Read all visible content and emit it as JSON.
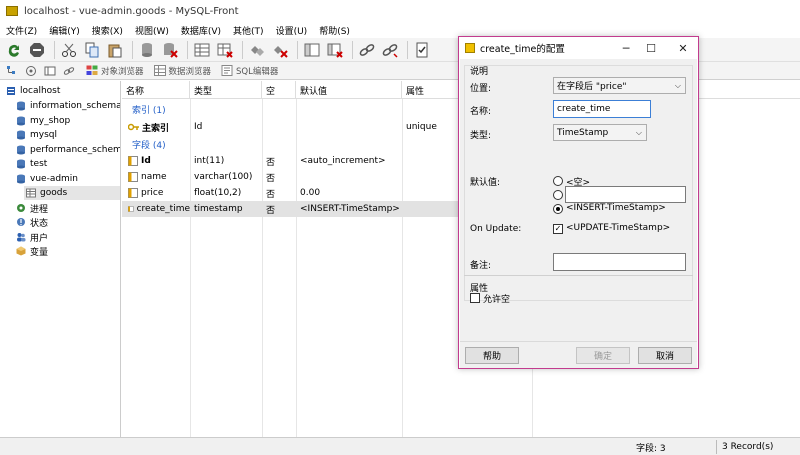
{
  "window": {
    "title": "localhost - vue-admin.goods - MySQL-Front"
  },
  "menu": [
    "文件(Z)",
    "编辑(Y)",
    "搜索(X)",
    "视图(W)",
    "数据库(V)",
    "其他(T)",
    "设置(U)",
    "帮助(S)"
  ],
  "views": {
    "object": "对象浏览器",
    "data": "数据浏览器",
    "sql": "SQL编辑器"
  },
  "tree": [
    {
      "label": "localhost",
      "icon": "server-icon"
    },
    {
      "label": "information_schema",
      "icon": "database-icon"
    },
    {
      "label": "my_shop",
      "icon": "database-icon"
    },
    {
      "label": "mysql",
      "icon": "database-icon"
    },
    {
      "label": "performance_schema",
      "icon": "database-icon"
    },
    {
      "label": "test",
      "icon": "database-icon"
    },
    {
      "label": "vue-admin",
      "icon": "database-icon"
    },
    {
      "label": "goods",
      "icon": "table-icon"
    },
    {
      "label": "进程",
      "icon": "process-icon"
    },
    {
      "label": "状态",
      "icon": "status-icon"
    },
    {
      "label": "用户",
      "icon": "users-icon"
    },
    {
      "label": "变量",
      "icon": "variables-icon"
    }
  ],
  "grid": {
    "headers": [
      "名称",
      "类型",
      "空",
      "默认值",
      "属性"
    ],
    "index_group": "索引 (1)",
    "field_group": "字段 (4)",
    "index_row": {
      "name": "主索引",
      "type": "Id",
      "attr": "unique"
    },
    "fields": [
      {
        "name": "Id",
        "type": "int(11)",
        "null": "否",
        "default": "<auto_increment>"
      },
      {
        "name": "name",
        "type": "varchar(100)",
        "null": "否",
        "default": ""
      },
      {
        "name": "price",
        "type": "float(10,2)",
        "null": "否",
        "default": "0.00"
      },
      {
        "name": "create_time",
        "type": "timestamp",
        "null": "否",
        "default": "<INSERT-TimeStamp>"
      }
    ]
  },
  "status": {
    "fields": "字段: 3",
    "records": "3 Record(s)"
  },
  "dialog": {
    "title": "create_time的配置",
    "group_desc": "说明",
    "position_label": "位置:",
    "position_value": "在字段后 \"price\"",
    "name_label": "名称:",
    "name_value": "create_time",
    "type_label": "类型:",
    "type_value": "TimeStamp",
    "default_label": "默认值:",
    "default_opt_empty": "<空>",
    "default_opt_insert": "<INSERT-TimeStamp>",
    "onupdate_label": "On Update:",
    "onupdate_value": "<UPDATE-TimeStamp>",
    "comment_label": "备注:",
    "group_attr": "属性",
    "allow_null": "允许空",
    "help_button": "帮助",
    "ok_button": "确定",
    "cancel_button": "取消"
  }
}
